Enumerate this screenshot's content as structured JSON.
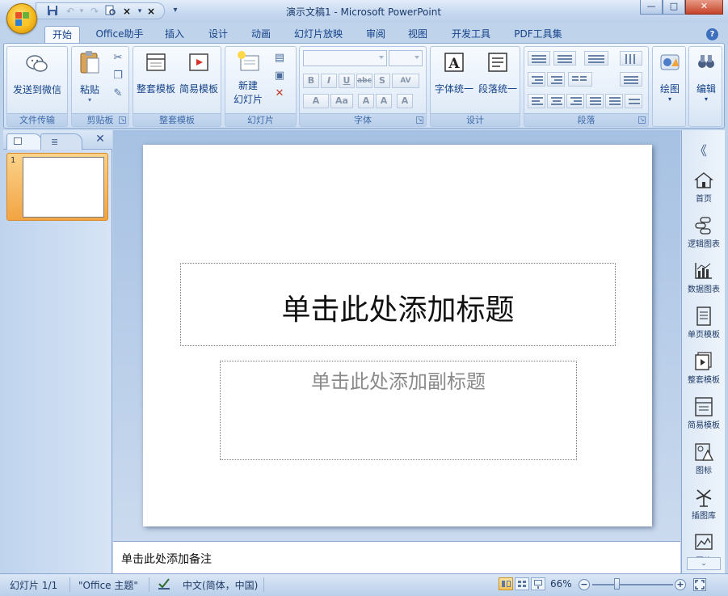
{
  "window": {
    "title": "演示文稿1 - Microsoft PowerPoint",
    "controls": [
      "—",
      "□",
      "✕"
    ]
  },
  "qat": {
    "icons": [
      "save-icon",
      "undo-icon",
      "redo-icon",
      "print-preview-icon",
      "cut-icon",
      "close-icon",
      "customize-icon"
    ]
  },
  "tabs": [
    "开始",
    "Office助手",
    "插入",
    "设计",
    "动画",
    "幻灯片放映",
    "审阅",
    "视图",
    "开发工具",
    "PDF工具集"
  ],
  "ribbon": {
    "groups": {
      "file_transfer": {
        "label": "文件传输",
        "send_wechat": "发送到微信"
      },
      "clipboard": {
        "label": "剪贴板",
        "paste": "粘贴"
      },
      "template": {
        "label": "整套模板",
        "full_template": "整套模板",
        "simple_template": "简易模板"
      },
      "slides": {
        "label": "幻灯片",
        "new_slide_line1": "新建",
        "new_slide_line2": "幻灯片"
      },
      "font": {
        "label": "字体",
        "buttons": [
          "B",
          "I",
          "U",
          "abc",
          "S",
          "AV",
          "A",
          "Aa",
          "A",
          "A",
          "A"
        ]
      },
      "design": {
        "label": "设计",
        "font_unify": "字体统一",
        "para_unify": "段落统一"
      },
      "paragraph": {
        "label": "段落"
      },
      "drawing": {
        "label": "绘图"
      },
      "editing": {
        "label": "编辑"
      }
    }
  },
  "left_panel": {
    "close": "✕",
    "slide_number": "1"
  },
  "slide": {
    "title_placeholder": "单击此处添加标题",
    "subtitle_placeholder": "单击此处添加副标题"
  },
  "notes": {
    "placeholder": "单击此处添加备注"
  },
  "right_sidebar": {
    "collapse": "《",
    "items": [
      {
        "label": "首页",
        "icon": "home-icon"
      },
      {
        "label": "逻辑图表",
        "icon": "logic-chart-icon"
      },
      {
        "label": "数据图表",
        "icon": "data-chart-icon"
      },
      {
        "label": "单页模板",
        "icon": "single-page-template-icon"
      },
      {
        "label": "整套模板",
        "icon": "full-template-icon"
      },
      {
        "label": "简易模板",
        "icon": "simple-template-icon"
      },
      {
        "label": "图标",
        "icon": "icon-library-icon"
      },
      {
        "label": "插图库",
        "icon": "illustration-library-icon"
      },
      {
        "label": "图片",
        "icon": "picture-icon"
      }
    ]
  },
  "statusbar": {
    "slide_info": "幻灯片 1/1",
    "theme": "\"Office 主题\"",
    "language": "中文(简体，中国)",
    "zoom": "66%",
    "zoom_level": 0.66
  },
  "colors": {
    "accent": "#15428b",
    "ribbon_border": "#8ba8d3",
    "office_button": "#f5b81c",
    "selected_thumb": "#f2a443"
  }
}
